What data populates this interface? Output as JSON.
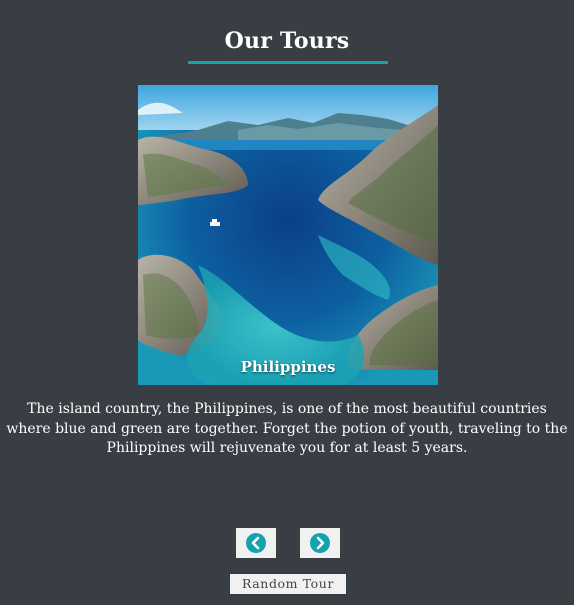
{
  "section": {
    "title": "Our Tours",
    "accent_color": "#14a3ad"
  },
  "tour": {
    "image_icon": "tropical-lagoon-photo",
    "name": "Philippines",
    "description": "The island country, the Philippines, is one of the most beautiful countries where blue and green are together. Forget the potion of youth, traveling to the Philippines will rejuvenate you for at least 5 years."
  },
  "controls": {
    "prev_icon": "chevron-left-circle-icon",
    "next_icon": "chevron-right-circle-icon",
    "random_label": "Random Tour"
  },
  "colors": {
    "background": "#393d44",
    "button_bg": "#f1f1f1"
  }
}
